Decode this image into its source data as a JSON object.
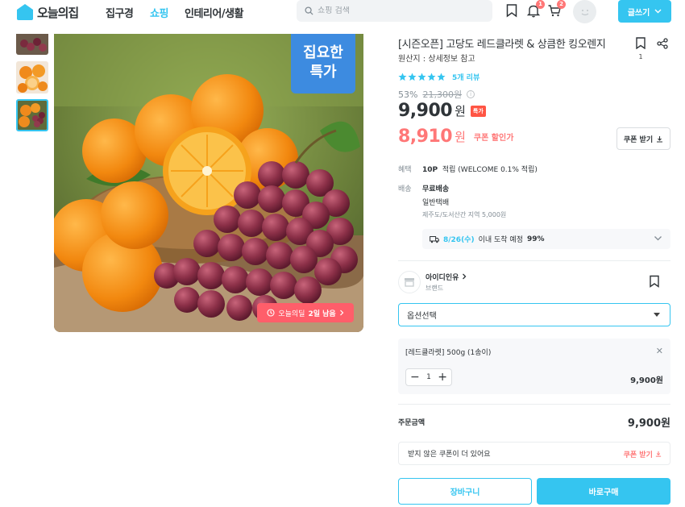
{
  "header": {
    "logo_text": "오늘의집",
    "nav": [
      "집구경",
      "쇼핑",
      "인테리어/생활"
    ],
    "search_placeholder": "쇼핑 검색",
    "notification_count": "1",
    "cart_count": "2",
    "write_label": "글쓰기",
    "accent": "#35c5f0"
  },
  "gallery": {
    "promo_tag_line1": "집요한",
    "promo_tag_line2": "특가",
    "timer_prefix": "오늘의딜",
    "timer_value": "2일 남음"
  },
  "product": {
    "title": "[시즌오픈] 고당도 레드클라렛 & 상큼한 킹오렌지",
    "origin": "원산지 : 상세정보 참고",
    "bookmark_count": "1",
    "rating_stars": 5,
    "review_count": "5개 리뷰",
    "discount_rate": "53%",
    "original_price": "21,300원",
    "price": "9,900",
    "price_unit": "원",
    "special_badge": "특가",
    "coupon_price": "8,910",
    "coupon_unit": "원",
    "coupon_label": "쿠폰 할인가",
    "coupon_button": "쿠폰 받기"
  },
  "benefits": {
    "label": "혜택",
    "points": "10P",
    "points_desc": "적립 (WELCOME 0.1% 적립)"
  },
  "shipping": {
    "label": "배송",
    "type": "무료배송",
    "method": "일반택배",
    "extra": "제주도/도서산간 지역 5,000원",
    "arrival_date": "8/26(수)",
    "arrival_text": "이내 도착 예정",
    "arrival_pct": "99%"
  },
  "brand": {
    "name": "아이디인유",
    "sub": "브랜드"
  },
  "options": {
    "placeholder": "옵션선택",
    "selected_name": "[레드클라렛] 500g (1송이)",
    "quantity": "1",
    "selected_price": "9,900원"
  },
  "summary": {
    "total_label": "주문금액",
    "total_price": "9,900원",
    "coupon_notice": "받지 않은 쿠폰이 더 있어요",
    "coupon_notice_action": "쿠폰 받기",
    "cart_button": "장바구니",
    "buy_button": "바로구매"
  }
}
